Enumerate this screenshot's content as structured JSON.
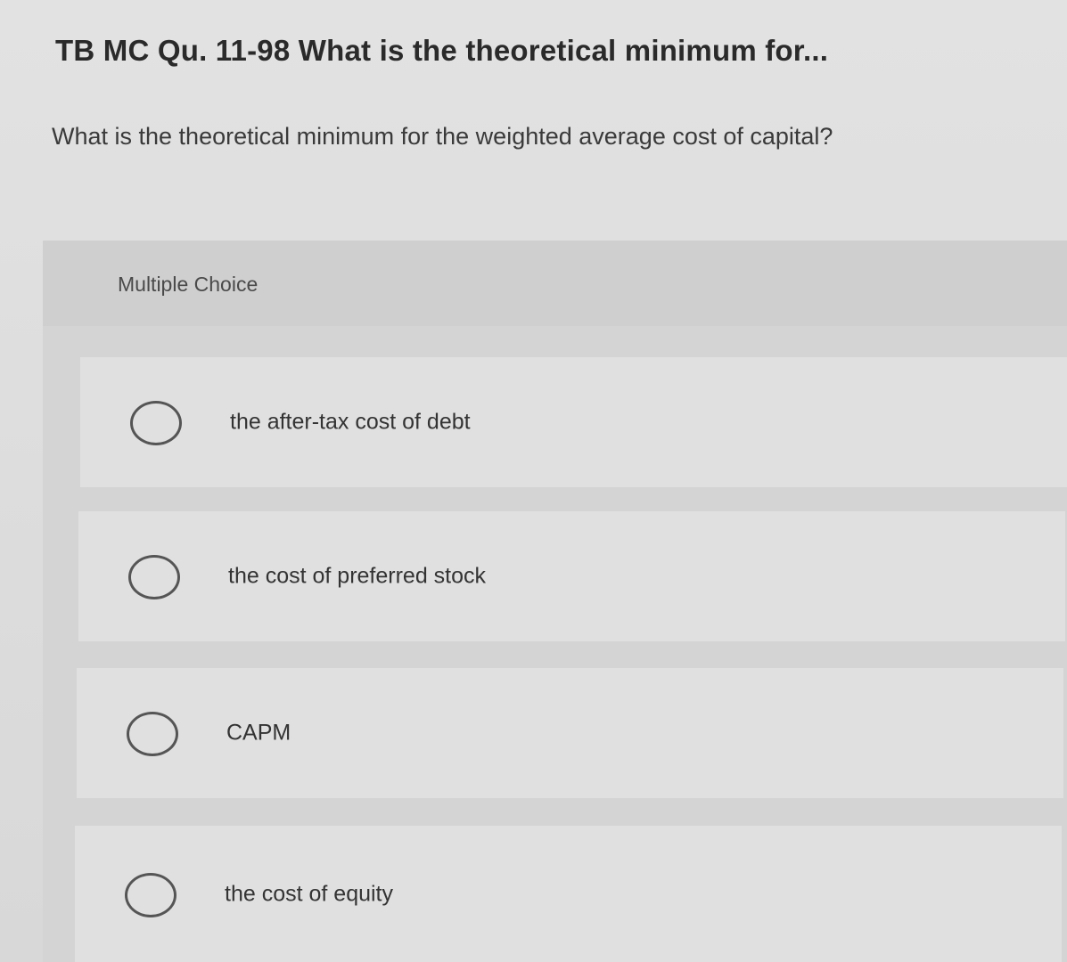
{
  "question_title": "TB MC Qu. 11-98 What is the theoretical minimum for...",
  "question_text": "What is the theoretical minimum for the weighted average cost of capital?",
  "multiple_choice": {
    "header": "Multiple Choice",
    "options": [
      {
        "label": "the after-tax cost of debt",
        "selected": false
      },
      {
        "label": "the cost of preferred stock",
        "selected": false
      },
      {
        "label": "CAPM",
        "selected": false
      },
      {
        "label": "the cost of equity",
        "selected": false
      }
    ]
  }
}
